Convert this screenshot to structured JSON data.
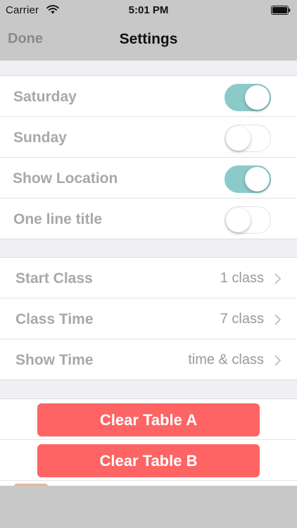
{
  "status_bar": {
    "carrier": "Carrier",
    "time": "5:01 PM"
  },
  "nav": {
    "done_label": "Done",
    "title": "Settings"
  },
  "toggles": [
    {
      "label": "Saturday",
      "on": true
    },
    {
      "label": "Sunday",
      "on": false
    },
    {
      "label": "Show Location",
      "on": true
    },
    {
      "label": "One line title",
      "on": false
    }
  ],
  "options": [
    {
      "label": "Start Class",
      "value": "1 class"
    },
    {
      "label": "Class Time",
      "value": "7 class"
    },
    {
      "label": "Show Time",
      "value": "time & class"
    }
  ],
  "actions": {
    "clear_a": "Clear Table A",
    "clear_b": "Clear Table B"
  },
  "colors": {
    "toggle_on": "#8ccaca",
    "destructive": "#fe6464",
    "bar_background": "#c8c8c8",
    "group_background": "#efeff4"
  },
  "icons": {
    "wifi": "wifi-icon",
    "battery": "battery-icon",
    "chevron": "chevron-right-icon"
  }
}
